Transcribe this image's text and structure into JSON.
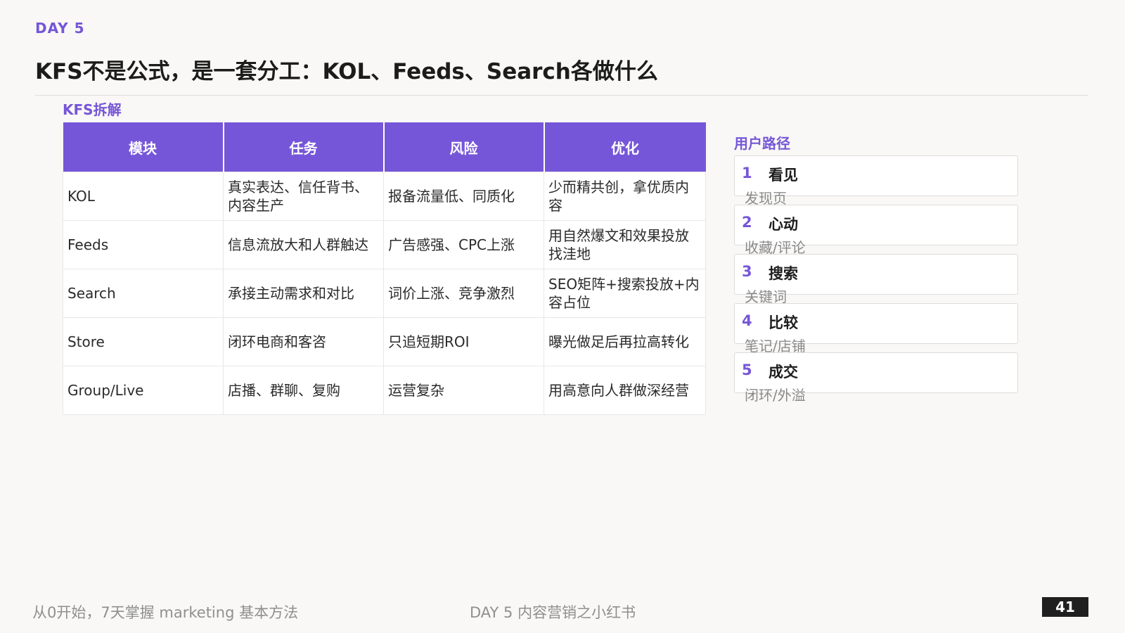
{
  "header": {
    "day_tag": "DAY 5",
    "title": "KFS不是公式，是一套分工：KOL、Feeds、Search各做什么"
  },
  "table_section": {
    "label": "KFS拆解",
    "columns": [
      "模块",
      "任务",
      "风险",
      "优化"
    ],
    "rows": [
      [
        "KOL",
        "真实表达、信任背书、内容生产",
        "报备流量低、同质化",
        "少而精共创，拿优质内容"
      ],
      [
        "Feeds",
        "信息流放大和人群触达",
        "广告感强、CPC上涨",
        "用自然爆文和效果投放找洼地"
      ],
      [
        "Search",
        "承接主动需求和对比",
        "词价上涨、竞争激烈",
        "SEO矩阵+搜索投放+内容占位"
      ],
      [
        "Store",
        "闭环电商和客咨",
        "只追短期ROI",
        "曝光做足后再拉高转化"
      ],
      [
        "Group/Live",
        "店播、群聊、复购",
        "运营复杂",
        "用高意向人群做深经营"
      ]
    ]
  },
  "path_section": {
    "label": "用户路径",
    "steps": [
      {
        "num": "1",
        "name": "看见",
        "desc": "发现页"
      },
      {
        "num": "2",
        "name": "心动",
        "desc": "收藏/评论"
      },
      {
        "num": "3",
        "name": "搜索",
        "desc": "关键词"
      },
      {
        "num": "4",
        "name": "比较",
        "desc": "笔记/店铺"
      },
      {
        "num": "5",
        "name": "成交",
        "desc": "闭环/外溢"
      }
    ]
  },
  "footer": {
    "left": "从0开始，7天掌握 marketing 基本方法",
    "middle": "DAY 5 内容营销之小红书",
    "page_number": "41"
  },
  "colors": {
    "accent": "#7656d8",
    "page_number_bg": "#1f1f1f"
  }
}
